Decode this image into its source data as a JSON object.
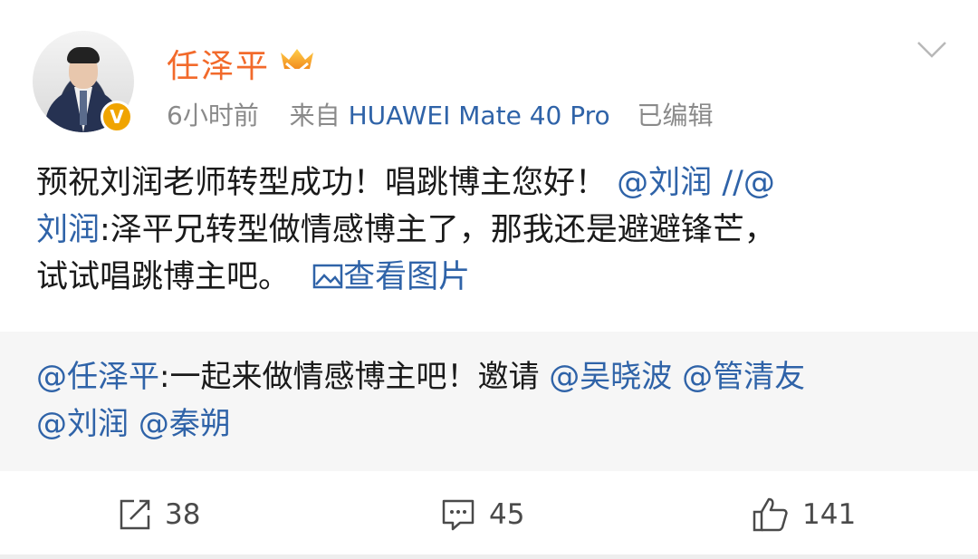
{
  "user": {
    "name": "任泽平",
    "verified_badge": "V",
    "accent": "#f26a2b"
  },
  "meta": {
    "time": "6小时前",
    "from_label": "来自",
    "device": "HUAWEI Mate 40 Pro",
    "edited": "已编辑"
  },
  "post": {
    "line1_text": "预祝刘润老师转型成功！唱跳博主您好！",
    "line1_mention": "@刘润",
    "line1_sep": "//@",
    "line2_mention": "刘润",
    "line2_text": ":泽平兄转型做情感博主了，那我还是避避锋芒，",
    "line3_text": "试试唱跳博主吧。",
    "view_image_label": "查看图片"
  },
  "repost": {
    "author_mention": "@任泽平",
    "text": ":一起来做情感博主吧！邀请",
    "mention1": "@吴晓波",
    "mention2": "@管清友",
    "mention3": "@刘润",
    "mention4": "@秦朔"
  },
  "actions": {
    "repost_count": "38",
    "comment_count": "45",
    "like_count": "141"
  },
  "icons": [
    "chevron-down-icon",
    "crown-badge-icon",
    "image-icon",
    "share-icon",
    "comment-icon",
    "like-icon"
  ]
}
